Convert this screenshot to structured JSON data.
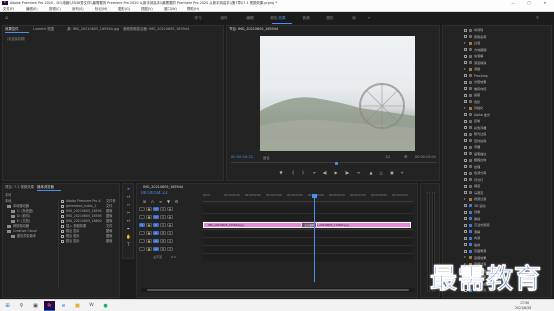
{
  "window": {
    "title": "Adobe Premiere Pro 2020 - D:\\\\电脑\\\\5038秀文件\\\\最需要的 Premiere Pro 2020 从新手到高手\\\\最需要的 Premiere Pro 2020 从新手到高手\\\\第7章\\\\7.1 视频效果.prproj *"
  },
  "menu": [
    "文件(F)",
    "编辑(E)",
    "剪辑(C)",
    "序列(S)",
    "标记(M)",
    "图形(G)",
    "视图(V)",
    "窗口(W)",
    "帮助(H)"
  ],
  "workspaces": [
    "学习",
    "组件",
    "编辑",
    "颜色",
    "效果",
    "音频",
    "图形",
    "库"
  ],
  "active_workspace": "效果",
  "source_panel": {
    "tabs": [
      "效果控件",
      "Lumetri 范围",
      "源: IMG_20210605_165944.jpg",
      "音频剪辑混合器: IMG_20210605_165944"
    ],
    "active_tab": "效果控件",
    "no_clip_text": "(未选择剪辑)"
  },
  "program_monitor": {
    "title": "节目: IMG_20210605_165944",
    "timecode_in": "00:00:04:22",
    "fit": "适合",
    "quality": "1/2",
    "timecode_out": "00:00:10:00"
  },
  "project_panel": {
    "tabs": [
      "项目: 7.1 视频效果",
      "媒体浏览器"
    ],
    "active_tab": "媒体浏览器",
    "location": "本地",
    "tree": [
      {
        "label": "本地",
        "kind": "header"
      },
      {
        "label": "本地驱动器",
        "kind": "folder"
      },
      {
        "label": "C: (系统盘)",
        "kind": "drive"
      },
      {
        "label": "D: (软件)",
        "kind": "drive"
      },
      {
        "label": "E: (文档)",
        "kind": "drive"
      },
      {
        "label": "网络驱动器",
        "kind": "folder"
      },
      {
        "label": "Creative Cloud",
        "kind": "folder"
      },
      {
        "label": "团队项目版本",
        "kind": "item"
      }
    ],
    "files": [
      {
        "name": "Adobe Premiere Pro A",
        "type": "文件夹"
      },
      {
        "name": "generated_index_2",
        "type": "文件"
      },
      {
        "name": "IMG_20210605_16594",
        "type": "图像"
      },
      {
        "name": "IMG_20210605_16595",
        "type": "图像"
      },
      {
        "name": "IMG_20210605_16600",
        "type": "图像"
      },
      {
        "name": "插入 视频效果",
        "type": "文件"
      },
      {
        "name": "跳出 图片",
        "type": "图像"
      },
      {
        "name": "跳出 图片",
        "type": "图像"
      },
      {
        "name": "跳出 图片",
        "type": "图像"
      }
    ]
  },
  "timeline": {
    "tab": "IMG_20210605_165944",
    "timecode": "00:00:04:22",
    "ruler": [
      "00:00",
      "00:00:01:00",
      "00:00:02:00",
      "00:00:03:00",
      "00:00:04:00",
      "00:00:05:00",
      "00:00:06:00",
      "00:00:07:00",
      "00:00:08:00",
      "00:00:09:00"
    ],
    "tracks": [
      {
        "name": "V3",
        "kind": "video"
      },
      {
        "name": "V2",
        "kind": "video"
      },
      {
        "name": "V1",
        "kind": "video"
      },
      {
        "name": "A1",
        "kind": "audio"
      },
      {
        "name": "A2",
        "kind": "audio"
      },
      {
        "name": "A3",
        "kind": "audio"
      },
      {
        "name": "主声道",
        "kind": "master",
        "value": "0.0"
      }
    ],
    "clips": [
      {
        "label": "IMG_20210605_165944.jpg",
        "track": "V1"
      },
      {
        "label": "IMG_20210605_170605.jpg",
        "track": "V1"
      }
    ],
    "transition_label": "交叉溶解"
  },
  "effects_panel": {
    "items": [
      {
        "label": "时间码",
        "icon": "grey"
      },
      {
        "label": "剪辑名称",
        "icon": "grey"
      },
      {
        "label": "过渡",
        "icon": "folder"
      },
      {
        "label": "方向模糊",
        "icon": "grey"
      },
      {
        "label": "块溶解",
        "icon": "grey"
      },
      {
        "label": "渐变擦除",
        "icon": "grey"
      },
      {
        "label": "调整",
        "icon": "folder"
      },
      {
        "label": "ProcAmp",
        "icon": "grey"
      },
      {
        "label": "光照效果",
        "icon": "grey"
      },
      {
        "label": "卷积内核",
        "icon": "grey"
      },
      {
        "label": "提取",
        "icon": "grey"
      },
      {
        "label": "色阶",
        "icon": "grey"
      },
      {
        "label": "风格化",
        "icon": "folder"
      },
      {
        "label": "Alpha 发光",
        "icon": "grey"
      },
      {
        "label": "复制",
        "icon": "grey"
      },
      {
        "label": "彩色浮雕",
        "icon": "grey"
      },
      {
        "label": "曝光过度",
        "icon": "grey"
      },
      {
        "label": "查找边缘",
        "icon": "grey"
      },
      {
        "label": "浮雕",
        "icon": "grey"
      },
      {
        "label": "画笔描边",
        "icon": "grey"
      },
      {
        "label": "粗糙边缘",
        "icon": "grey"
      },
      {
        "label": "纹理",
        "icon": "grey"
      },
      {
        "label": "色调分离",
        "icon": "grey"
      },
      {
        "label": "闪光灯",
        "icon": "grey"
      },
      {
        "label": "阈值",
        "icon": "grey"
      },
      {
        "label": "马赛克",
        "icon": "grey"
      },
      {
        "label": "视频过渡",
        "icon": "folder"
      },
      {
        "label": "3D 运动",
        "icon": "blue"
      },
      {
        "label": "划像",
        "icon": "blue"
      },
      {
        "label": "擦除",
        "icon": "blue"
      },
      {
        "label": "沉浸式视频",
        "icon": "blue"
      },
      {
        "label": "溶解",
        "icon": "blue"
      },
      {
        "label": "内滑",
        "icon": "blue"
      },
      {
        "label": "缩放",
        "icon": "blue"
      },
      {
        "label": "页面剥落",
        "icon": "blue"
      },
      {
        "label": "音频效果",
        "icon": "folder"
      },
      {
        "label": "音频过渡",
        "icon": "folder"
      },
      {
        "label": "交叉淡化",
        "icon": "blue"
      },
      {
        "label": "恒定功率",
        "icon": "blue"
      },
      {
        "label": "恒定增益",
        "icon": "blue"
      },
      {
        "label": "指数淡化",
        "icon": "blue"
      }
    ]
  },
  "watermark": "最需教育",
  "taskbar": {
    "time": "17:50",
    "date": "2021/6/26",
    "apps": [
      "开始",
      "搜索",
      "任务视图",
      "Premiere Pro",
      "Edge",
      "文件资源管理器",
      "Word",
      "微信"
    ]
  },
  "colors": {
    "accent": "#4a8ff0",
    "clip": "#e88ad8",
    "playhead": "#4a8ff0",
    "panel": "#232323"
  }
}
